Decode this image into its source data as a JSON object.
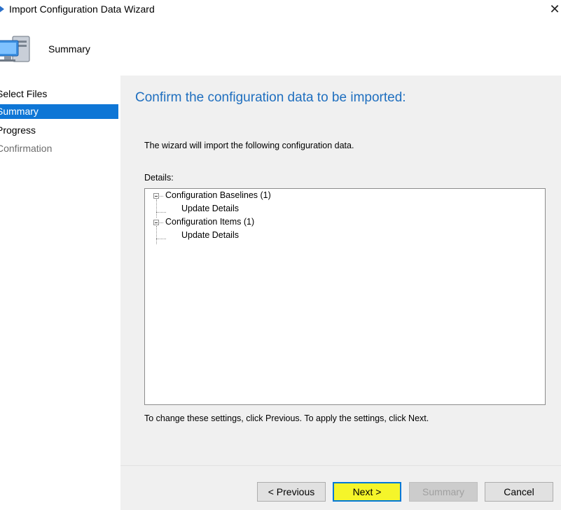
{
  "window": {
    "title": "Import Configuration Data Wizard",
    "close_glyph": "✕"
  },
  "header": {
    "title": "Summary",
    "icon": "computer-wizard-icon"
  },
  "nav": {
    "items": [
      {
        "label": "Select Files",
        "state": "normal"
      },
      {
        "label": "Summary",
        "state": "active"
      },
      {
        "label": "Progress",
        "state": "normal"
      },
      {
        "label": "Confirmation",
        "state": "disabled"
      }
    ]
  },
  "main": {
    "heading": "Confirm the configuration data to be imported:",
    "intro": "The wizard will import the following configuration data.",
    "details_label": "Details:",
    "tree": {
      "nodes": [
        {
          "label": "Configuration Baselines (1)",
          "children": [
            "Update Details"
          ]
        },
        {
          "label": "Configuration Items (1)",
          "children": [
            "Update Details"
          ]
        }
      ]
    },
    "footer_note": "To change these settings, click Previous. To apply the settings, click Next."
  },
  "buttons": {
    "previous": "< Previous",
    "next": "Next >",
    "summary": "Summary",
    "cancel": "Cancel"
  },
  "colors": {
    "accent": "#0e76d6",
    "heading": "#1f6fbf",
    "highlight": "#f5f52a"
  }
}
